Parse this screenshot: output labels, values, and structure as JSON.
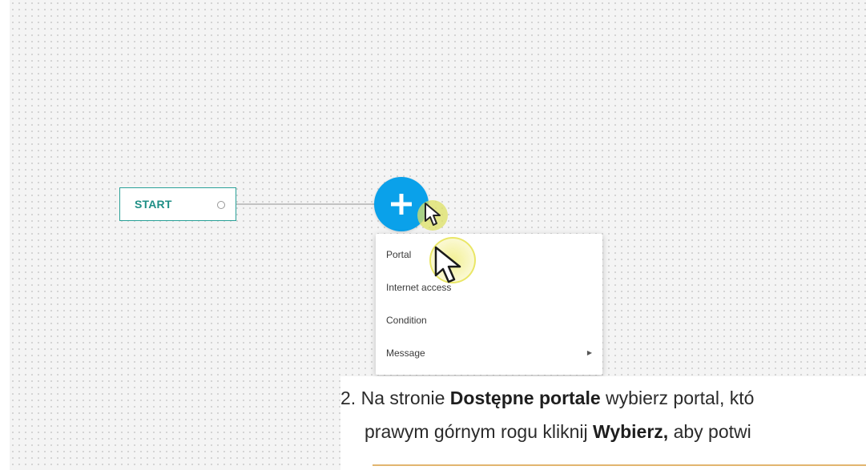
{
  "flow_canvas": {
    "start_node": {
      "label": "START"
    },
    "add_button": {
      "icon": "plus-icon",
      "color": "#0aa1ea"
    },
    "context_menu": {
      "items": [
        {
          "label": "Portal"
        },
        {
          "label": "Internet access"
        },
        {
          "label": "Condition"
        },
        {
          "label": "Message",
          "has_submenu": true
        }
      ]
    }
  },
  "instructions": {
    "step2": {
      "number": "2.",
      "line1_pre": "Na stronie ",
      "line1_bold": "Dostępne portale",
      "line1_post": " wybierz portal, któ",
      "line2_pre": "prawym górnym rogu kliknij ",
      "line2_bold": "Wybierz,",
      "line2_post": " aby potwi"
    }
  },
  "colors": {
    "accent_teal": "#1f8f86",
    "add_blue": "#0aa1ea",
    "cursor_highlight": "#e8e45a",
    "doc_rule": "#e2b56f"
  }
}
